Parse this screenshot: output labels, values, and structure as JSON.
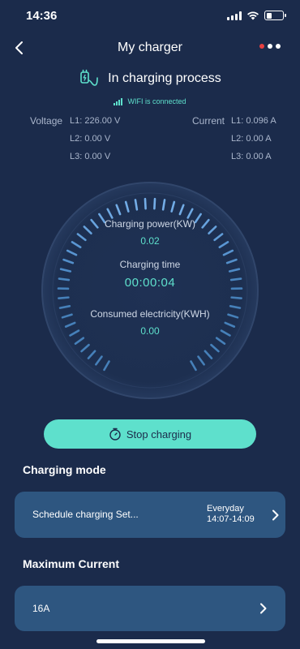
{
  "status_bar": {
    "time": "14:36"
  },
  "nav": {
    "title": "My charger"
  },
  "charge_status": {
    "text": "In charging process"
  },
  "wifi": {
    "text": "WIFI is connected"
  },
  "voltage": {
    "label": "Voltage",
    "l1": "L1: 226.00 V",
    "l2": "L2: 0.00 V",
    "l3": "L3: 0.00 V"
  },
  "current": {
    "label": "Current",
    "l1": "L1: 0.096 A",
    "l2": "L2: 0.00 A",
    "l3": "L3: 0.00 A"
  },
  "gauge": {
    "power_label": "Charging power(KW)",
    "power_value": "0.02",
    "time_label": "Charging time",
    "time_value": "00:00:04",
    "energy_label": "Consumed electricity(KWH)",
    "energy_value": "0.00"
  },
  "stop_button": {
    "label": "Stop charging"
  },
  "charging_mode": {
    "title": "Charging mode",
    "schedule_label": "Schedule charging Set...",
    "schedule_days": "Everyday",
    "schedule_time": "14:07-14:09"
  },
  "max_current": {
    "title": "Maximum Current",
    "value": "16A"
  },
  "colors": {
    "background": "#1b2b4b",
    "accent": "#5ee0cc",
    "card": "#2e5680",
    "notification": "#e84040"
  }
}
